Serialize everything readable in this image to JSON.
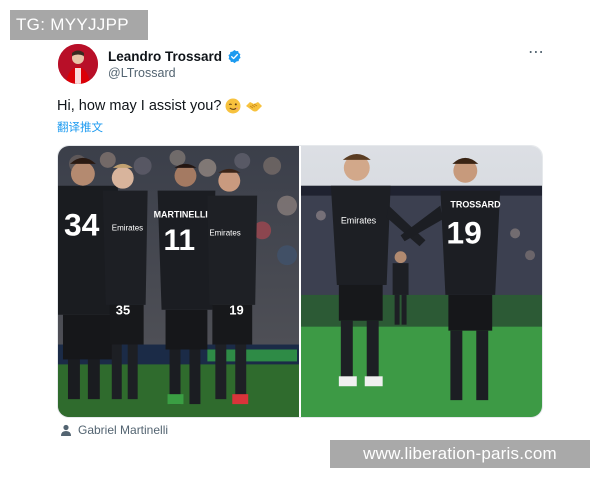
{
  "overlay": {
    "tg_label": "TG: MYYJJPP",
    "watermark": "www.liberation-paris.com"
  },
  "tweet": {
    "display_name": "Leandro Trossard",
    "handle": "@LTrossard",
    "text": "Hi, how may I assist you?",
    "emojis": [
      "winking-face-emoji",
      "handshake-emoji"
    ],
    "translate_link": "翻译推文",
    "tagged_person": "Gabriel Martinelli",
    "more_icon": "⋯",
    "verified_color": "#1d9bf0",
    "photos": [
      {
        "name": "celebration-photo-left",
        "jersey_numbers": [
          "34",
          "11",
          "19",
          "35"
        ],
        "jersey_names": [
          "MARTINELLI",
          "Emirates",
          "Emirates"
        ]
      },
      {
        "name": "celebration-photo-right",
        "jersey_numbers": [
          "19"
        ],
        "jersey_names": [
          "TROSSARD",
          "Emirates"
        ]
      }
    ]
  }
}
